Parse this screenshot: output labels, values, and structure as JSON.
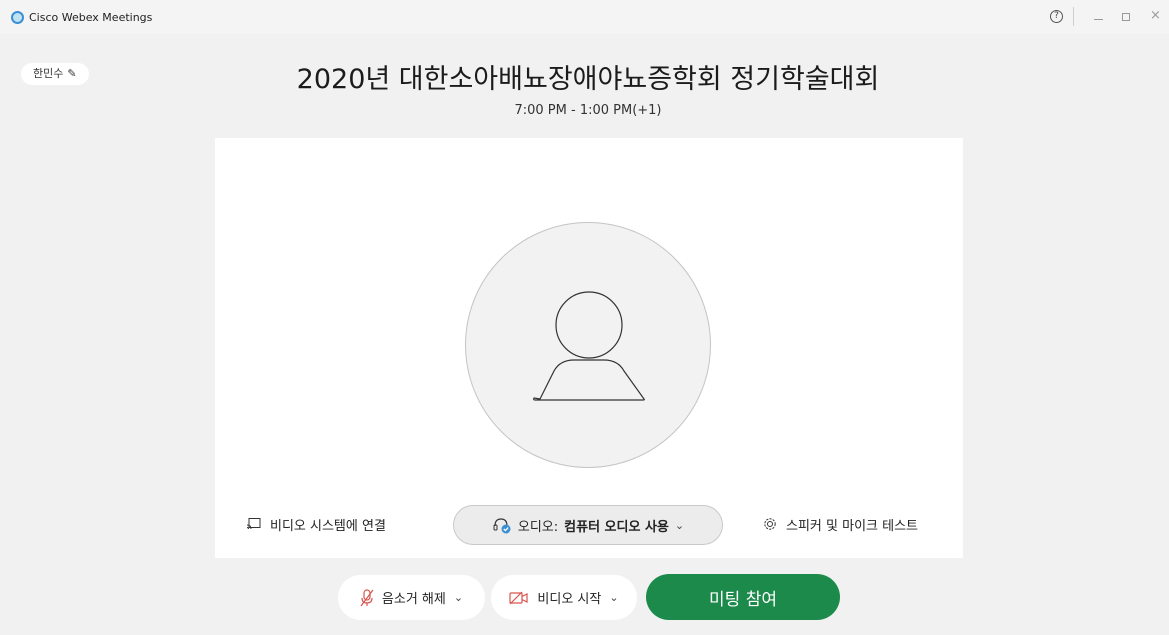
{
  "window": {
    "app_title": "Cisco Webex Meetings",
    "help_label": "?",
    "close_label": "×",
    "logo_icon": "webex-logo-icon"
  },
  "user": {
    "name": "한민수",
    "edit_icon": "✎"
  },
  "meeting": {
    "title": "2020년 대한소아배뇨장애야뇨증학회 정기학술대회",
    "time": "7:00 PM - 1:00 PM(+1)"
  },
  "preview": {
    "avatar_icon": "person-silhouette-icon",
    "connect_video_system_label": "비디오 시스템에 연결",
    "audio_prefix": "오디오: ",
    "audio_value": "컴퓨터 오디오 사용",
    "audio_chevron": "⌄",
    "speaker_mic_test_label": "스피커 및 마이크 테스트"
  },
  "controls": {
    "unmute_label": "음소거 해제",
    "start_video_label": "비디오 시작",
    "chevron": "⌄",
    "join_label": "미팅 참여"
  },
  "colors": {
    "join_green": "#1c8a4a",
    "muted_red": "#d9534f",
    "accent_blue": "#3b8fd4"
  }
}
